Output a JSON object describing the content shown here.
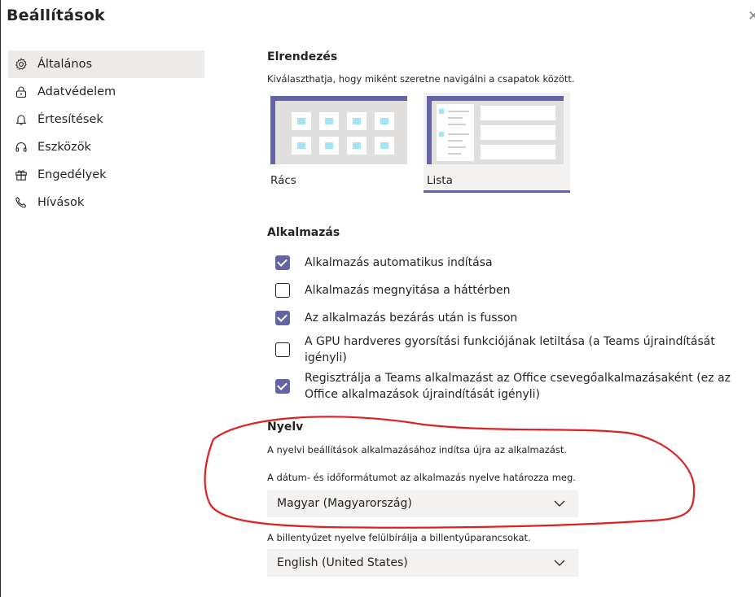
{
  "window": {
    "title": "Beállítások",
    "close_glyph": "✕"
  },
  "sidebar": {
    "items": [
      {
        "label": "Általános",
        "icon": "gear-icon",
        "active": true
      },
      {
        "label": "Adatvédelem",
        "icon": "lock-icon",
        "active": false
      },
      {
        "label": "Értesítések",
        "icon": "bell-icon",
        "active": false
      },
      {
        "label": "Eszközök",
        "icon": "headset-icon",
        "active": false
      },
      {
        "label": "Engedélyek",
        "icon": "gift-icon",
        "active": false
      },
      {
        "label": "Hívások",
        "icon": "phone-icon",
        "active": false
      }
    ]
  },
  "layout_section": {
    "title": "Elrendezés",
    "description": "Kiválaszthatja, hogy miként szeretne navigálni a csapatok között.",
    "options": [
      {
        "label": "Rács",
        "selected": false
      },
      {
        "label": "Lista",
        "selected": true
      }
    ]
  },
  "app_section": {
    "title": "Alkalmazás",
    "options": [
      {
        "line1": "Alkalmazás automatikus indítása",
        "line2": "",
        "checked": true
      },
      {
        "line1": "Alkalmazás megnyitása a háttérben",
        "line2": "",
        "checked": false
      },
      {
        "line1": "Az alkalmazás bezárás után is fusson",
        "line2": "",
        "checked": true
      },
      {
        "line1": "A GPU hardveres gyorsítási funkciójának letiltása (a Teams újraindítását",
        "line2": "igényli)",
        "checked": false
      },
      {
        "line1": "Regisztrálja a Teams alkalmazást az Office csevegőalkalmazásaként (ez az",
        "line2": "Office alkalmazások újraindítását igényli)",
        "checked": true
      }
    ]
  },
  "language_section": {
    "title": "Nyelv",
    "note1": "A nyelvi beállítások alkalmazásához indítsa újra az alkalmazást.",
    "note2": "A dátum- és időformátumot az alkalmazás nyelve határozza meg.",
    "app_language": "Magyar (Magyarország)",
    "keyboard_note": "A billentyűzet nyelve felülbírálja a billentyűparancsokat.",
    "keyboard_language": "English (United States)"
  },
  "colors": {
    "accent": "#6264a7",
    "annotation": "#e02020",
    "selected_bg": "#f3f2f1"
  }
}
